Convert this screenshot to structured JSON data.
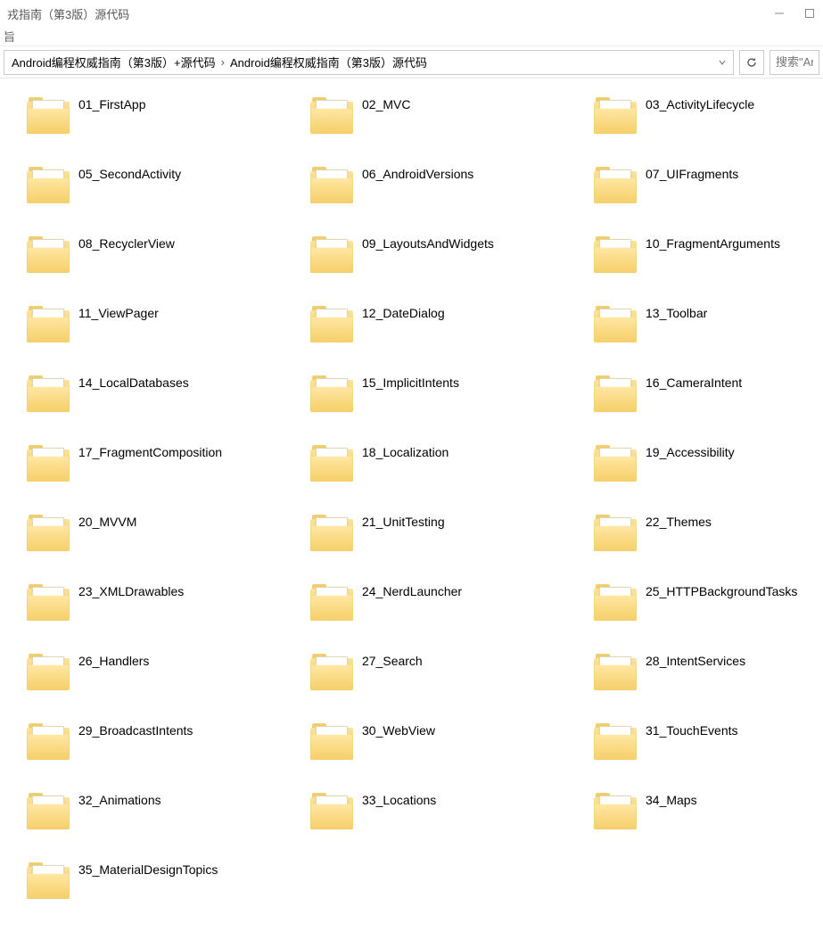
{
  "window": {
    "title": "戎指南（第3版）源代码"
  },
  "ribbon": {
    "stub": "旨"
  },
  "breadcrumb": {
    "segments": [
      "Android编程权威指南（第3版）+源代码",
      "Android编程权威指南（第3版）源代码"
    ],
    "separator": "›"
  },
  "search": {
    "placeholder": "搜索\"An"
  },
  "folders": [
    {
      "name": "01_FirstApp"
    },
    {
      "name": "02_MVC"
    },
    {
      "name": "03_ActivityLifecycle"
    },
    {
      "name": "05_SecondActivity"
    },
    {
      "name": "06_AndroidVersions"
    },
    {
      "name": "07_UIFragments"
    },
    {
      "name": "08_RecyclerView"
    },
    {
      "name": "09_LayoutsAndWidgets"
    },
    {
      "name": "10_FragmentArguments"
    },
    {
      "name": "11_ViewPager"
    },
    {
      "name": "12_DateDialog"
    },
    {
      "name": "13_Toolbar"
    },
    {
      "name": "14_LocalDatabases"
    },
    {
      "name": "15_ImplicitIntents"
    },
    {
      "name": "16_CameraIntent"
    },
    {
      "name": "17_FragmentComposition"
    },
    {
      "name": "18_Localization"
    },
    {
      "name": "19_Accessibility"
    },
    {
      "name": "20_MVVM"
    },
    {
      "name": "21_UnitTesting"
    },
    {
      "name": "22_Themes"
    },
    {
      "name": "23_XMLDrawables"
    },
    {
      "name": "24_NerdLauncher"
    },
    {
      "name": "25_HTTPBackgroundTasks"
    },
    {
      "name": "26_Handlers"
    },
    {
      "name": "27_Search"
    },
    {
      "name": "28_IntentServices"
    },
    {
      "name": "29_BroadcastIntents"
    },
    {
      "name": "30_WebView"
    },
    {
      "name": "31_TouchEvents"
    },
    {
      "name": "32_Animations"
    },
    {
      "name": "33_Locations"
    },
    {
      "name": "34_Maps"
    },
    {
      "name": "35_MaterialDesignTopics"
    }
  ]
}
